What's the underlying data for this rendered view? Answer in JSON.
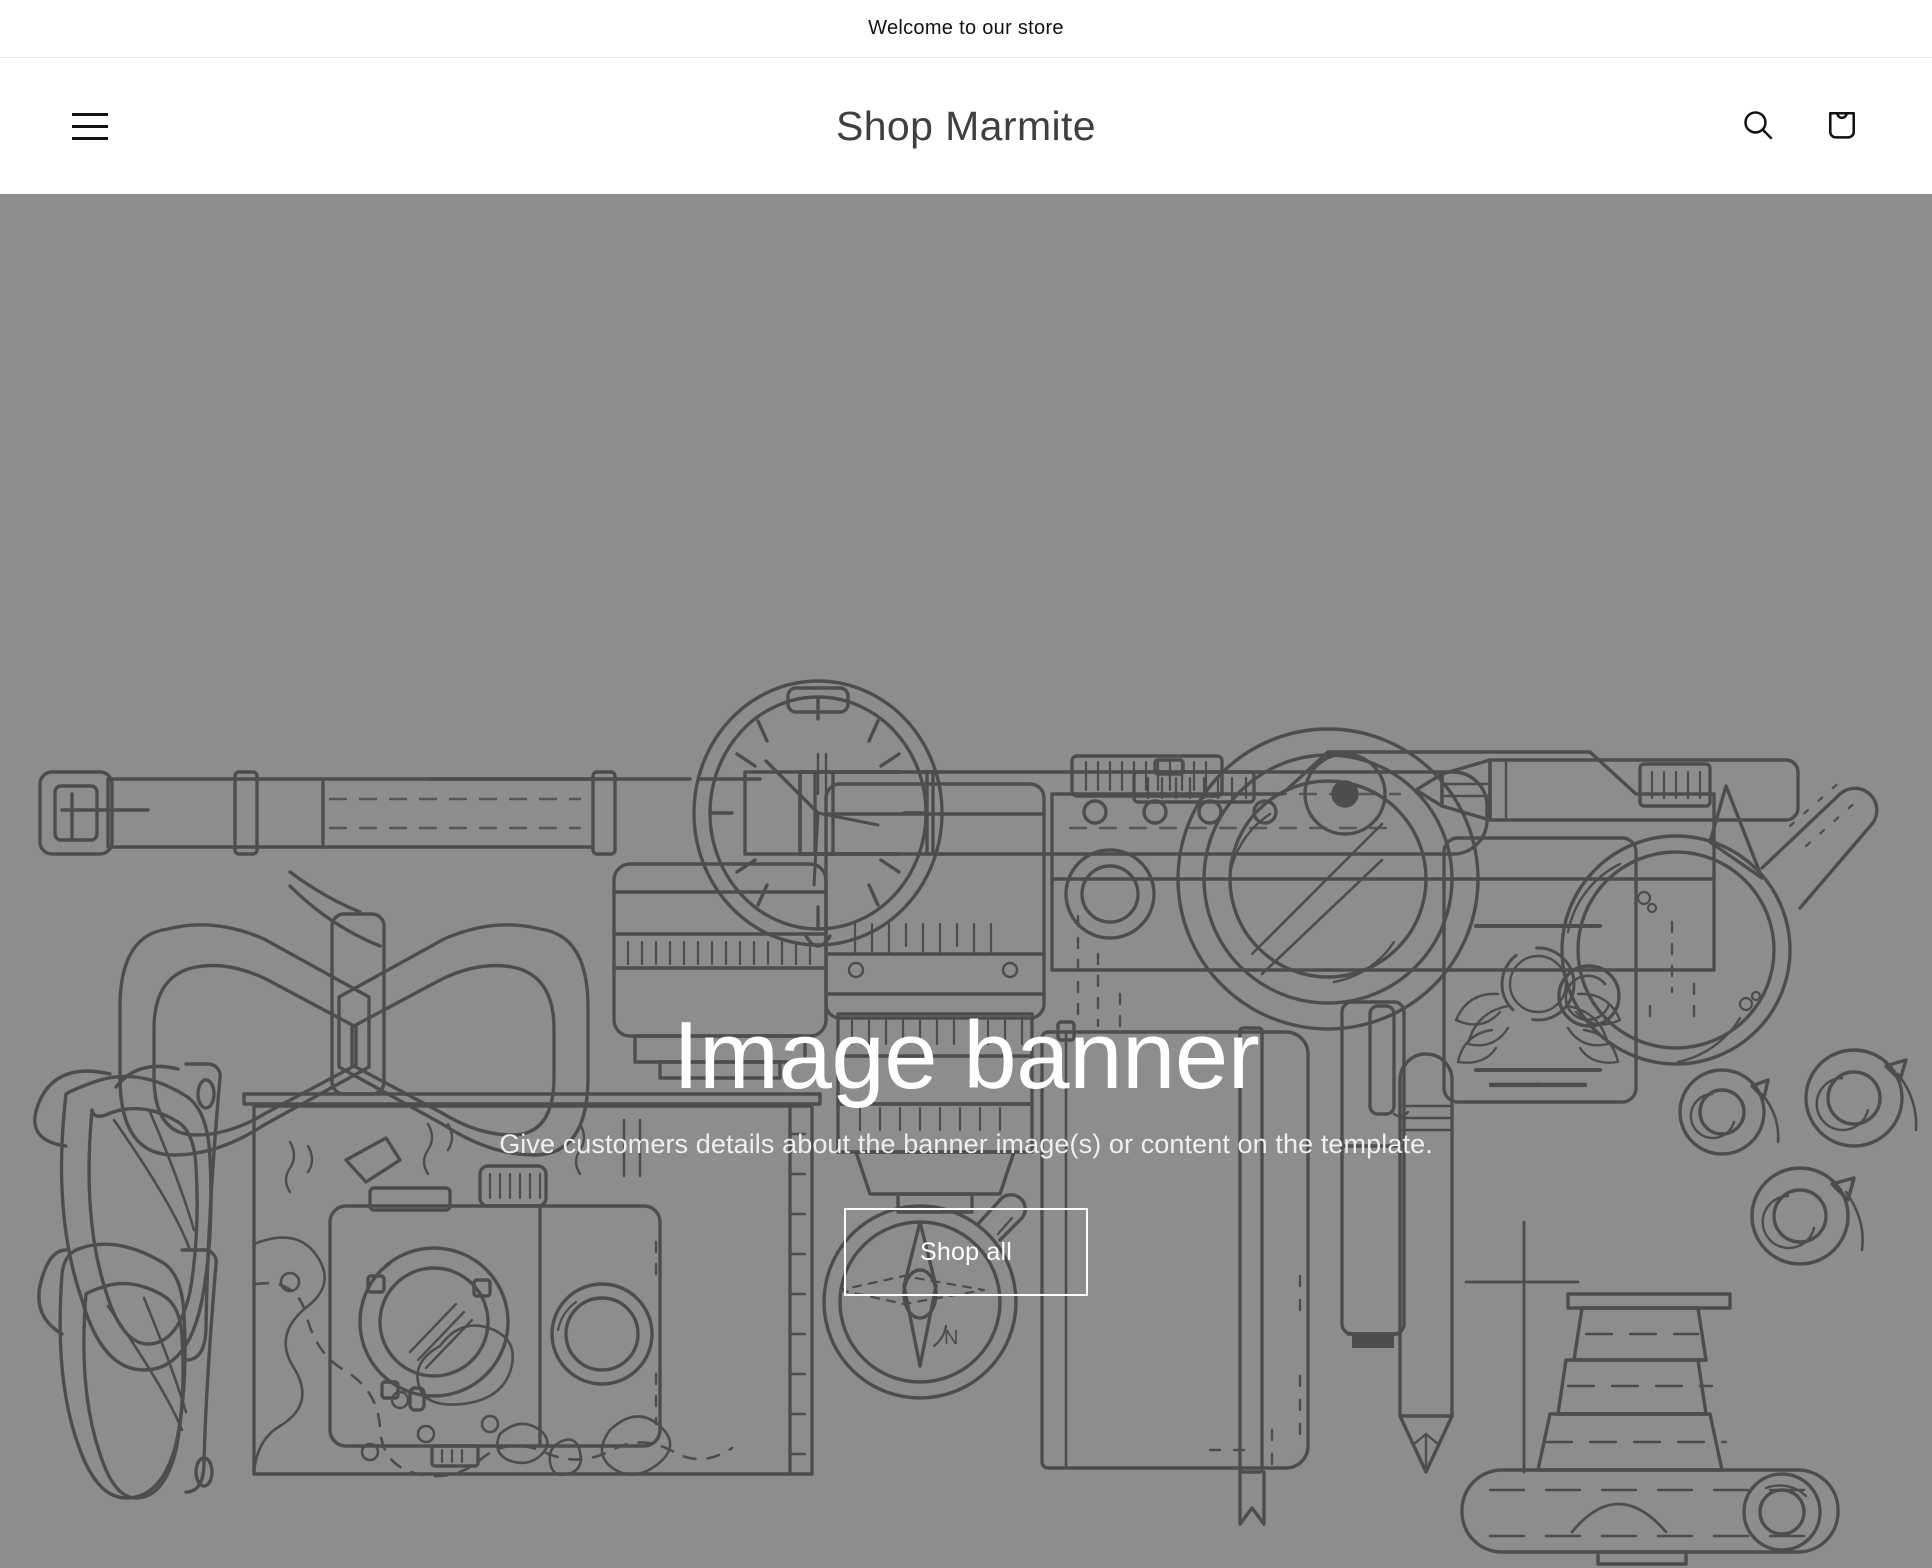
{
  "announcement": {
    "text": "Welcome to our store"
  },
  "header": {
    "menu_icon": "hamburger-menu-icon",
    "store_name": "Shop Marmite",
    "search_icon": "search-icon",
    "cart_icon": "shopping-bag-icon",
    "search_label": "Search",
    "cart_label": "Cart"
  },
  "banner": {
    "heading": "Image banner",
    "subheading": "Give customers details about the banner image(s) or content on the template.",
    "button_label": "Shop all",
    "background_color": "#8d8d8d",
    "line_color": "#4a4a4a",
    "text_color": "#ffffff",
    "illustration_name": "flat-lay-line-art-illustration",
    "illustration_items": [
      "wrist-watch",
      "bow-tie",
      "camera-lens-short",
      "camera-zoom-lens",
      "slr-camera",
      "pencil-long",
      "tablet-certificate",
      "coffee-mug",
      "sunglasses",
      "folded-map",
      "twin-lens-camera",
      "notebook",
      "fountain-pen",
      "pencil",
      "compass",
      "tape-roll-small",
      "tape-roll-medium",
      "tape-roll-large",
      "lens-on-camera-body"
    ]
  }
}
